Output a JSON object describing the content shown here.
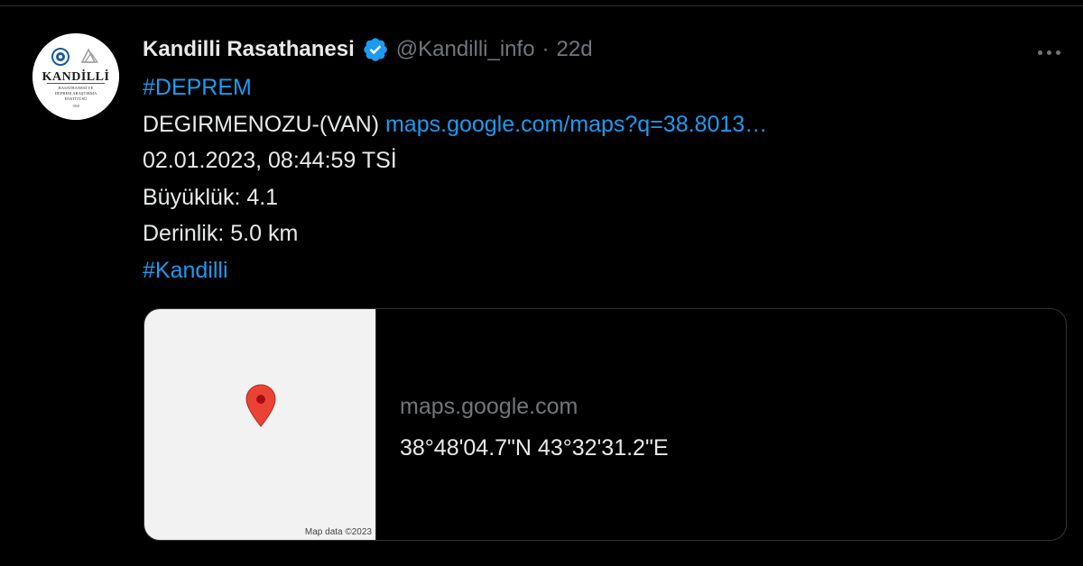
{
  "tweet": {
    "author": {
      "display_name": "Kandilli Rasathanesi",
      "handle": "@Kandilli_info",
      "verified": true,
      "avatar_logo_text": "KANDİLLİ RASATHANESİ VE DEPREM ARAŞTIRMA ENSTİTÜSÜ"
    },
    "separator": "·",
    "timestamp": "22d",
    "lines": {
      "hashtag_1": "#DEPREM",
      "location": "DEGIRMENOZU-(VAN) ",
      "location_link": "maps.google.com/maps?q=38.8013…",
      "datetime": "02.01.2023, 08:44:59 TSİ",
      "magnitude": "Büyüklük: 4.1",
      "depth": "Derinlik: 5.0 km",
      "hashtag_2": "#Kandilli"
    },
    "card": {
      "domain": "maps.google.com",
      "title": "38°48'04.7\"N 43°32'31.2\"E",
      "map_attribution": "Map data ©2023"
    }
  },
  "colors": {
    "background": "#000000",
    "text_primary": "#e7e9ea",
    "text_secondary": "#71767b",
    "link": "#1d9bf0",
    "verified_badge": "#1d9bf0",
    "border": "#2f3336",
    "map_background": "#f2f2f2",
    "map_pin": "#ea4335"
  },
  "icons": {
    "verified": "verified-badge-icon",
    "more": "more-horizontal-icon",
    "map_pin": "map-pin-icon"
  }
}
